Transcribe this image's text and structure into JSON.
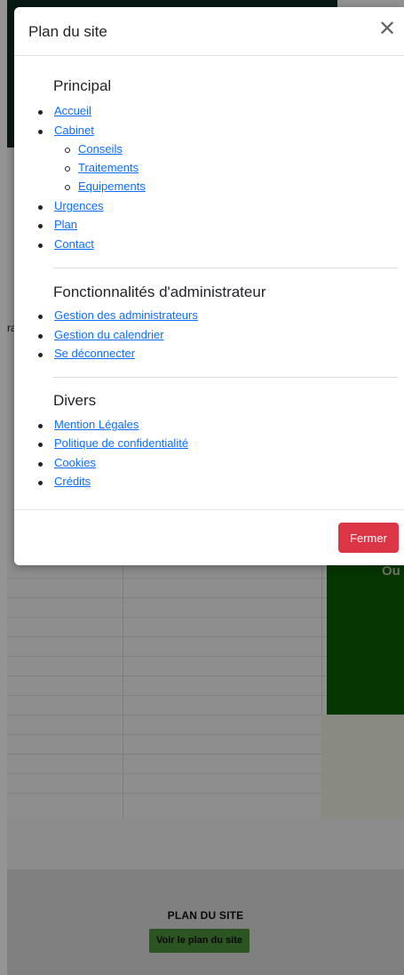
{
  "background": {
    "edge_text": "ra",
    "green_text": "Ou",
    "footer_title": "PLAN DU SITE",
    "footer_button": "Voir le plan du site"
  },
  "modal": {
    "title": "Plan du site",
    "close_symbol": "✕",
    "sections": {
      "principal": {
        "title": "Principal",
        "items": [
          "Accueil",
          "Cabinet",
          "Urgences",
          "Plan",
          "Contact"
        ],
        "cabinet_sub": [
          "Conseils",
          "Traitements",
          "Equipements"
        ]
      },
      "admin": {
        "title": "Fonctionnalités d'administrateur",
        "items": [
          "Gestion des administrateurs",
          "Gestion du calendrier",
          "Se déconnecter"
        ]
      },
      "divers": {
        "title": "Divers",
        "items": [
          "Mention Légales",
          "Politique de confidentialité",
          "Cookies",
          "Crédits"
        ]
      }
    },
    "close_button": "Fermer"
  },
  "colors": {
    "link": "#0d6efd",
    "danger": "#dc3545",
    "topbar": "#0f2a23",
    "green": "#0b5d05"
  }
}
